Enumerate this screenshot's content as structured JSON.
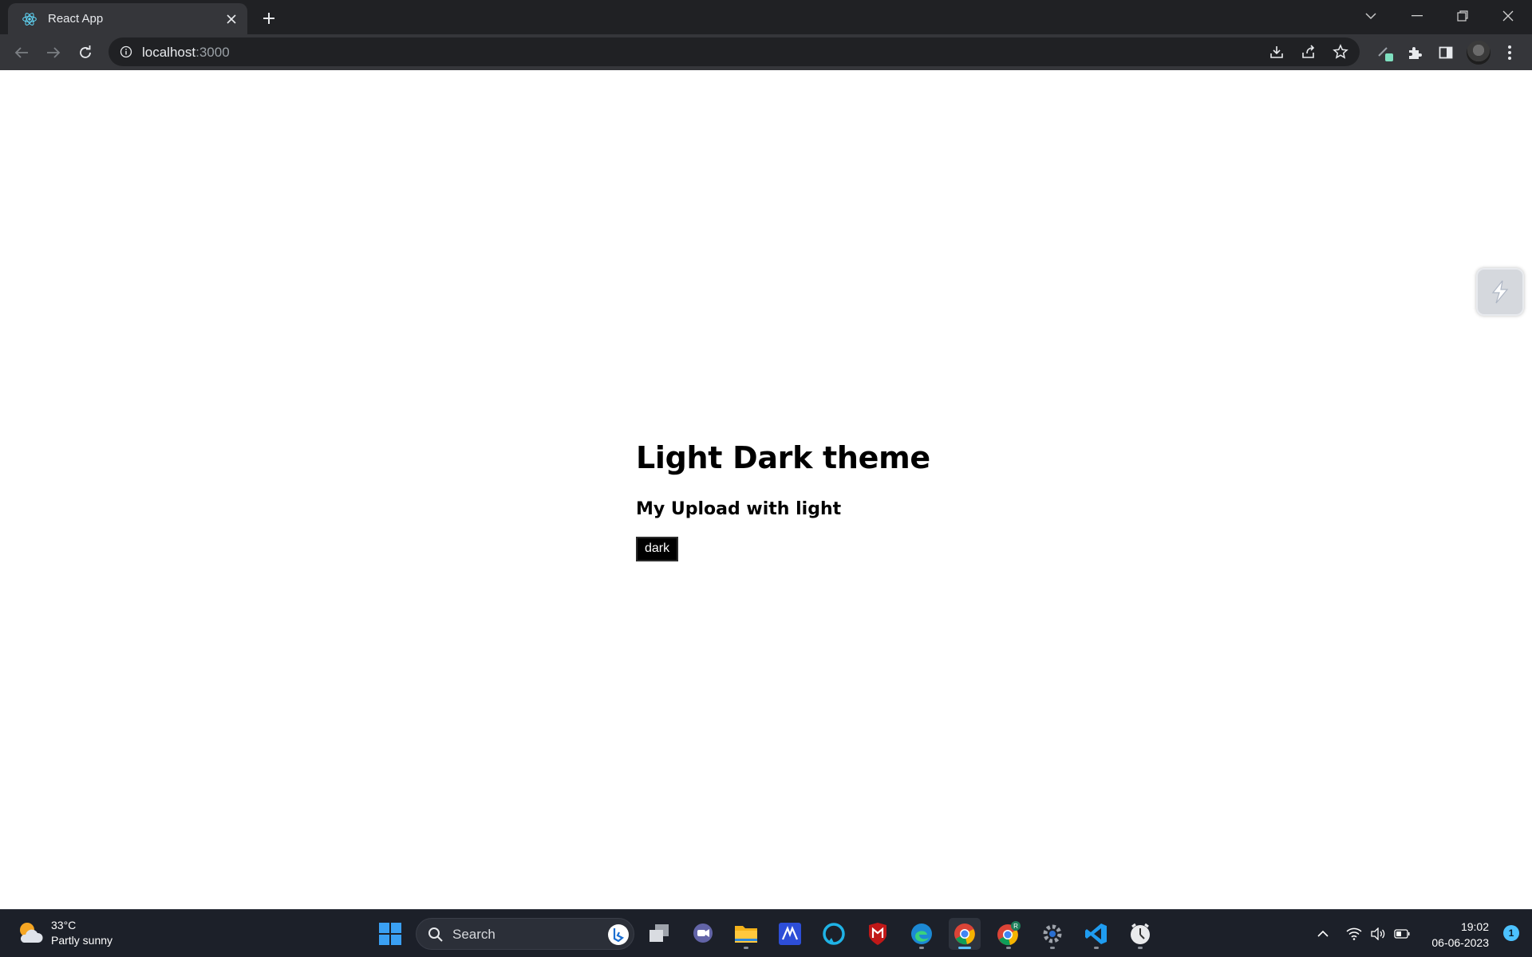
{
  "browser": {
    "tab_title": "React App",
    "url_host": "localhost",
    "url_port": ":3000"
  },
  "page": {
    "heading": "Light Dark theme",
    "subheading": "My Upload with light",
    "theme_button_label": "dark"
  },
  "taskbar": {
    "weather_temp": "33°C",
    "weather_desc": "Partly sunny",
    "search_label": "Search",
    "time": "19:02",
    "date": "06-06-2023",
    "notification_count": "1",
    "apps": [
      "windows-start",
      "task-view",
      "teams-chat",
      "file-explorer",
      "app-m",
      "alexa",
      "mcafee",
      "edge",
      "chrome",
      "chrome-profile-r",
      "settings",
      "vscode",
      "clock-app"
    ]
  },
  "colors": {
    "chrome_dark": "#202124",
    "chrome_toolbar": "#35363a",
    "taskbar_bg": "#1c2029",
    "button_bg": "#000000",
    "accent": "#4cc2ff"
  }
}
